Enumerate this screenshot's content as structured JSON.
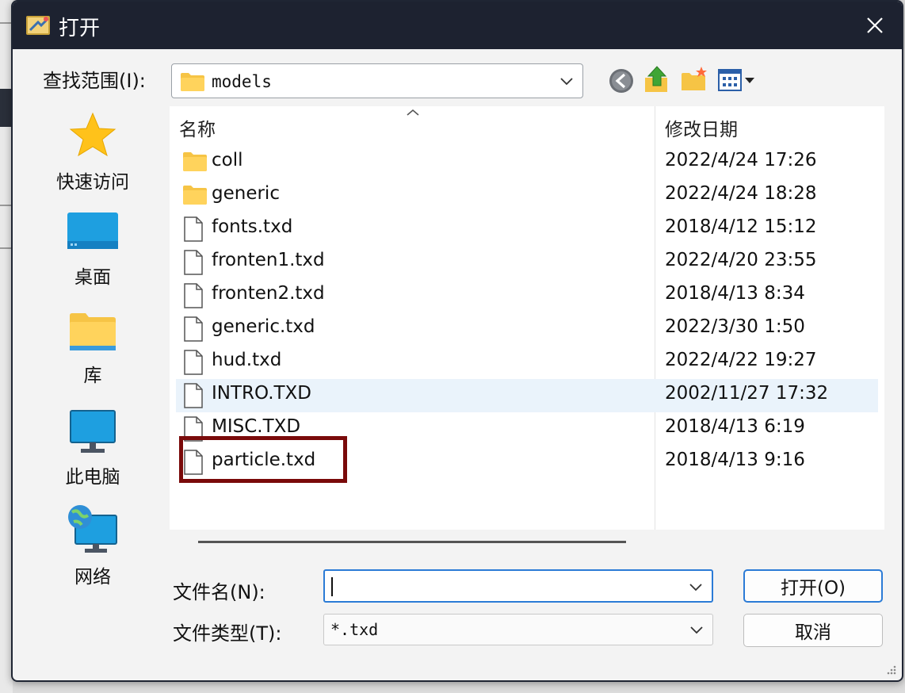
{
  "window": {
    "title": "打开"
  },
  "look_in": {
    "label": "查找范围(I):",
    "value": "models"
  },
  "toolbar": {
    "back_icon": "back-arrow-icon",
    "up_icon": "up-folder-icon",
    "new_folder_icon": "new-folder-icon",
    "view_icon": "view-menu-icon"
  },
  "places": [
    {
      "label": "快速访问",
      "icon": "star-icon"
    },
    {
      "label": "桌面",
      "icon": "desktop-icon"
    },
    {
      "label": "库",
      "icon": "library-folder-icon"
    },
    {
      "label": "此电脑",
      "icon": "computer-icon"
    },
    {
      "label": "网络",
      "icon": "network-icon"
    }
  ],
  "file_list": {
    "columns": [
      "名称",
      "修改日期"
    ],
    "rows": [
      {
        "name": "coll",
        "date": "2022/4/24 17:26",
        "type": "folder"
      },
      {
        "name": "generic",
        "date": "2022/4/24 18:28",
        "type": "folder"
      },
      {
        "name": "fonts.txd",
        "date": "2018/4/12 15:12",
        "type": "file"
      },
      {
        "name": "fronten1.txd",
        "date": "2022/4/20 23:55",
        "type": "file"
      },
      {
        "name": "fronten2.txd",
        "date": "2018/4/13 8:34",
        "type": "file"
      },
      {
        "name": "generic.txd",
        "date": "2022/3/30 1:50",
        "type": "file"
      },
      {
        "name": "hud.txd",
        "date": "2022/4/22 19:27",
        "type": "file"
      },
      {
        "name": "INTRO.TXD",
        "date": "2002/11/27 17:32",
        "type": "file",
        "hovered": true
      },
      {
        "name": "MISC.TXD",
        "date": "2018/4/13 6:19",
        "type": "file"
      },
      {
        "name": "particle.txd",
        "date": "2018/4/13 9:16",
        "type": "file",
        "annotated": true
      }
    ]
  },
  "file_name": {
    "label": "文件名(N):",
    "value": ""
  },
  "file_type": {
    "label": "文件类型(T):",
    "value": "*.txd"
  },
  "buttons": {
    "open": "打开(O)",
    "cancel": "取消"
  },
  "colors": {
    "titlebar": "#1d2230",
    "accent": "#2b7bd6",
    "annotation": "#7a0a0a",
    "hover_row": "#eaf3fb"
  }
}
